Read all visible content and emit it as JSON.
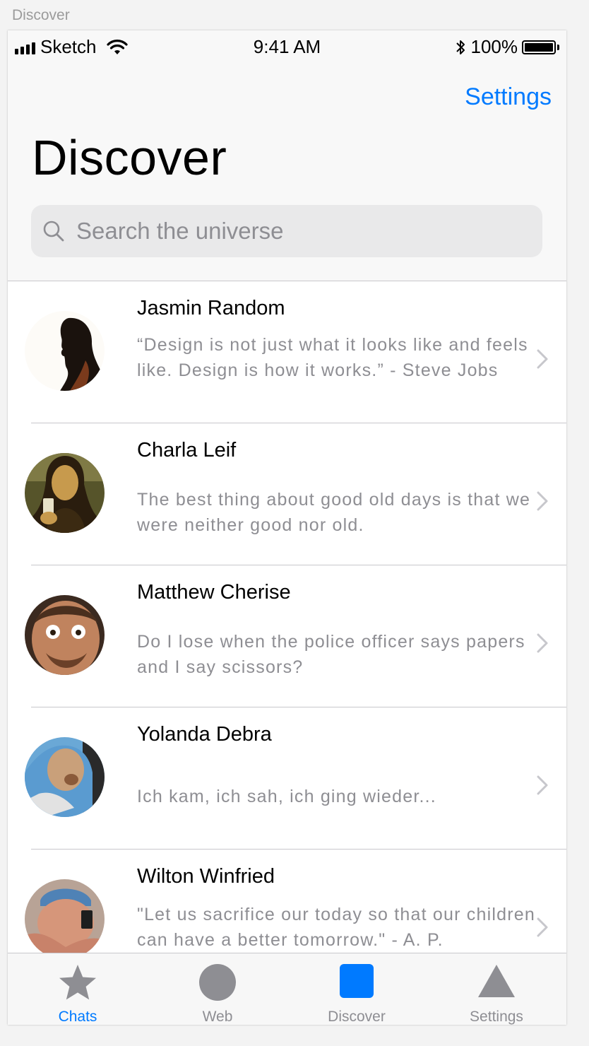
{
  "artboard": {
    "label": "Discover"
  },
  "status_bar": {
    "carrier": "Sketch",
    "time": "9:41 AM",
    "battery": "100%"
  },
  "nav": {
    "right_action": "Settings",
    "title": "Discover"
  },
  "search": {
    "placeholder": "Search the universe"
  },
  "contacts": [
    {
      "name": "Jasmin Random",
      "message": "“Design is not just what it looks like and feels like. Design is how it works.” - Steve Jobs"
    },
    {
      "name": "Charla Leif",
      "message": "The best thing about good old days is that we were neither good nor old."
    },
    {
      "name": "Matthew Cherise",
      "message": "Do I lose when the police officer says papers and I say scissors?"
    },
    {
      "name": "Yolanda Debra",
      "message": "Ich kam, ich sah, ich ging wieder..."
    },
    {
      "name": "Wilton Winfried",
      "message": "\"Let us sacrifice our today so that our children can have a better tomorrow.\" - A. P."
    }
  ],
  "tabs": [
    {
      "label": "Chats",
      "icon": "star-icon",
      "active": true
    },
    {
      "label": "Web",
      "icon": "circle-icon",
      "active": false
    },
    {
      "label": "Discover",
      "icon": "square-icon",
      "active": false
    },
    {
      "label": "Settings",
      "icon": "triangle-icon",
      "active": false
    }
  ],
  "colors": {
    "accent": "#007aff",
    "secondary_text": "#8e8e93",
    "separator": "#c8c7cc",
    "tab_icon_gray": "#8e8e93"
  }
}
